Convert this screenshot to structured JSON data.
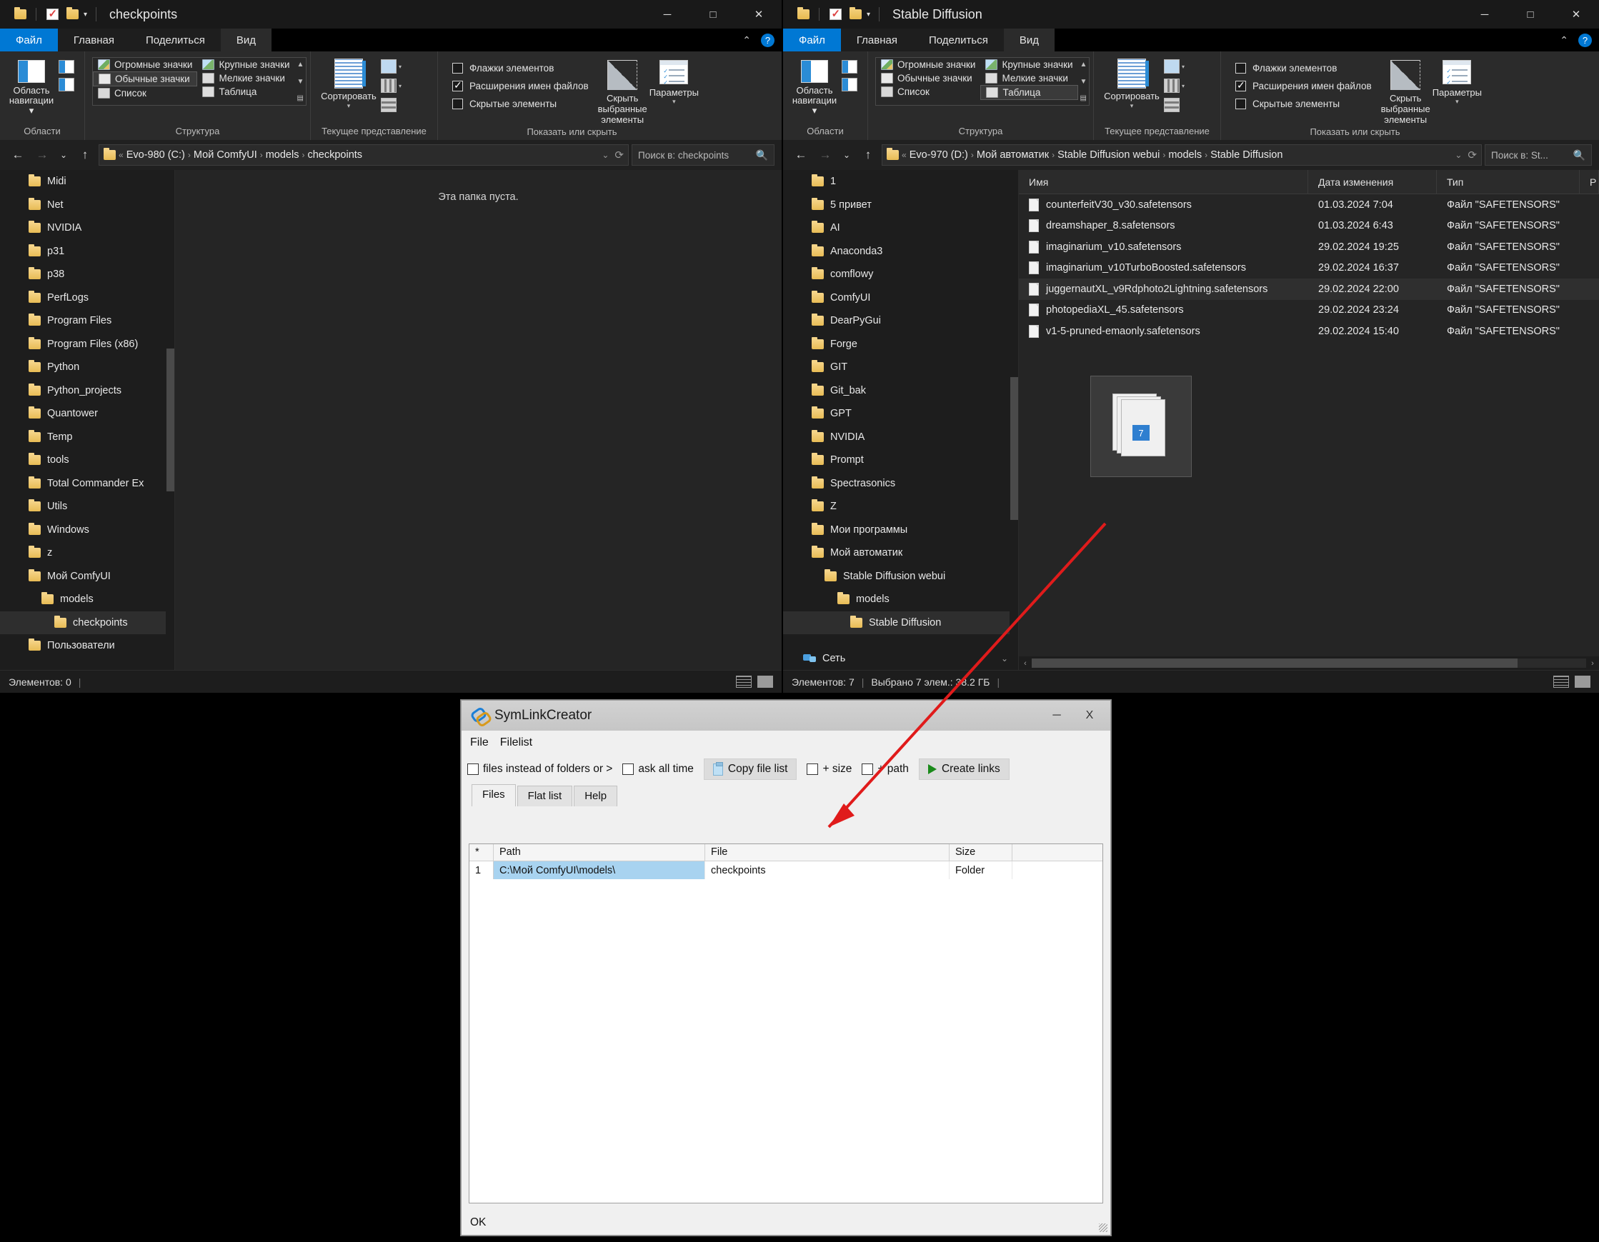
{
  "left_window": {
    "title": "checkpoints",
    "ribbon_tabs": [
      {
        "label": "Файл"
      },
      {
        "label": "Главная"
      },
      {
        "label": "Поделиться"
      },
      {
        "label": "Вид"
      }
    ],
    "groups": {
      "panes": {
        "label": "Области",
        "nav_button": "Область\nнавигации"
      },
      "layout": {
        "label": "Структура",
        "items": [
          "Огромные значки",
          "Крупные значки",
          "Обычные значки",
          "Мелкие значки",
          "Список",
          "Таблица"
        ],
        "selected": "Обычные значки"
      },
      "current_view": {
        "label": "Текущее представление",
        "sort": "Сортировать"
      },
      "show_hide": {
        "label": "Показать или скрыть",
        "checkboxes": [
          {
            "label": "Флажки элементов",
            "checked": false
          },
          {
            "label": "Расширения имен файлов",
            "checked": true
          },
          {
            "label": "Скрытые элементы",
            "checked": false
          }
        ],
        "hide_selected": "Скрыть выбранные\nэлементы",
        "options": "Параметры"
      }
    },
    "address": {
      "crumbs": [
        "Evo-980 (C:)",
        "Мой ComfyUI",
        "models",
        "checkpoints"
      ],
      "prefix": "«"
    },
    "search_placeholder": "Поиск в: checkpoints",
    "tree": [
      {
        "label": "Midi",
        "level": 0
      },
      {
        "label": "Net",
        "level": 0
      },
      {
        "label": "NVIDIA",
        "level": 0
      },
      {
        "label": "p31",
        "level": 0
      },
      {
        "label": "p38",
        "level": 0
      },
      {
        "label": "PerfLogs",
        "level": 0
      },
      {
        "label": "Program Files",
        "level": 0
      },
      {
        "label": "Program Files (x86)",
        "level": 0
      },
      {
        "label": "Python",
        "level": 0
      },
      {
        "label": "Python_projects",
        "level": 0
      },
      {
        "label": "Quantower",
        "level": 0
      },
      {
        "label": "Temp",
        "level": 0
      },
      {
        "label": "tools",
        "level": 0
      },
      {
        "label": "Total Commander Ex",
        "level": 0
      },
      {
        "label": "Utils",
        "level": 0
      },
      {
        "label": "Windows",
        "level": 0
      },
      {
        "label": "z",
        "level": 0
      },
      {
        "label": "Мой ComfyUI",
        "level": 0
      },
      {
        "label": "models",
        "level": 1
      },
      {
        "label": "checkpoints",
        "level": 2,
        "selected": true
      },
      {
        "label": "Пользователи",
        "level": 0
      }
    ],
    "empty_message": "Эта папка пуста.",
    "status": "Элементов: 0"
  },
  "right_window": {
    "title": "Stable Diffusion",
    "ribbon_tabs": [
      {
        "label": "Файл"
      },
      {
        "label": "Главная"
      },
      {
        "label": "Поделиться"
      },
      {
        "label": "Вид"
      }
    ],
    "groups": {
      "panes": {
        "label": "Области",
        "nav_button": "Область\nнавигации"
      },
      "layout": {
        "label": "Структура",
        "items": [
          "Огромные значки",
          "Крупные значки",
          "Обычные значки",
          "Мелкие значки",
          "Список",
          "Таблица"
        ],
        "selected": "Таблица"
      },
      "current_view": {
        "label": "Текущее представление",
        "sort": "Сортировать"
      },
      "show_hide": {
        "label": "Показать или скрыть",
        "checkboxes": [
          {
            "label": "Флажки элементов",
            "checked": false
          },
          {
            "label": "Расширения имен файлов",
            "checked": true
          },
          {
            "label": "Скрытые элементы",
            "checked": false
          }
        ],
        "hide_selected": "Скрыть выбранные\nэлементы",
        "options": "Параметры"
      }
    },
    "address": {
      "crumbs": [
        "Evo-970 (D:)",
        "Мой автоматик",
        "Stable Diffusion webui",
        "models",
        "Stable Diffusion"
      ],
      "prefix": "«"
    },
    "search_placeholder": "Поиск в: St...",
    "tree": [
      {
        "label": "1",
        "level": 0
      },
      {
        "label": "5 привет",
        "level": 0
      },
      {
        "label": "AI",
        "level": 0
      },
      {
        "label": "Anaconda3",
        "level": 0
      },
      {
        "label": "comflowy",
        "level": 0
      },
      {
        "label": "ComfyUI",
        "level": 0
      },
      {
        "label": "DearPyGui",
        "level": 0
      },
      {
        "label": "Forge",
        "level": 0
      },
      {
        "label": "GIT",
        "level": 0
      },
      {
        "label": "Git_bak",
        "level": 0
      },
      {
        "label": "GPT",
        "level": 0
      },
      {
        "label": "NVIDIA",
        "level": 0
      },
      {
        "label": "Prompt",
        "level": 0
      },
      {
        "label": "Spectrasonics",
        "level": 0
      },
      {
        "label": "Z",
        "level": 0
      },
      {
        "label": "Мои программы",
        "level": 0
      },
      {
        "label": "Мой автоматик",
        "level": 0
      },
      {
        "label": "Stable Diffusion webui",
        "level": 1
      },
      {
        "label": "models",
        "level": 2
      },
      {
        "label": "Stable Diffusion",
        "level": 3,
        "selected": true
      }
    ],
    "network_label": "Сеть",
    "columns": [
      "Имя",
      "Дата изменения",
      "Тип",
      "Р"
    ],
    "files": [
      {
        "name": "counterfeitV30_v30.safetensors",
        "date": "01.03.2024 7:04",
        "type": "Файл \"SAFETENSORS\""
      },
      {
        "name": "dreamshaper_8.safetensors",
        "date": "01.03.2024 6:43",
        "type": "Файл \"SAFETENSORS\""
      },
      {
        "name": "imaginarium_v10.safetensors",
        "date": "29.02.2024 19:25",
        "type": "Файл \"SAFETENSORS\""
      },
      {
        "name": "imaginarium_v10TurboBoosted.safetensors",
        "date": "29.02.2024 16:37",
        "type": "Файл \"SAFETENSORS\""
      },
      {
        "name": "juggernautXL_v9Rdphoto2Lightning.safetensors",
        "date": "29.02.2024 22:00",
        "type": "Файл \"SAFETENSORS\"",
        "highlighted": true
      },
      {
        "name": "photopediaXL_45.safetensors",
        "date": "29.02.2024 23:24",
        "type": "Файл \"SAFETENSORS\""
      },
      {
        "name": "v1-5-pruned-emaonly.safetensors",
        "date": "29.02.2024 15:40",
        "type": "Файл \"SAFETENSORS\""
      }
    ],
    "drag_badge": "7",
    "status_items": "Элементов: 7",
    "status_selected": "Выбрано 7 элем.: 38.2 ГБ"
  },
  "symlink_dialog": {
    "title": "SymLinkCreator",
    "menu": [
      "File",
      "Filelist"
    ],
    "toolbar": {
      "files_instead": "files instead of folders or >",
      "ask_all_time": "ask all time",
      "copy_file_list": "Copy file list",
      "plus_size": "+ size",
      "plus_path": "+ path",
      "create_links": "Create links"
    },
    "tabs": [
      {
        "label": "Files",
        "active": true
      },
      {
        "label": "Flat list",
        "active": false
      },
      {
        "label": "Help",
        "active": false
      }
    ],
    "grid_headers": [
      "*",
      "Path",
      "File",
      "Size"
    ],
    "rows": [
      {
        "num": "1",
        "path": "C:\\Мой ComfyUI\\models\\",
        "file": "checkpoints",
        "size": "Folder"
      }
    ],
    "status": "OK"
  },
  "window_controls": {
    "minimize": "─",
    "maximize": "□",
    "close": "✕"
  },
  "colors": {
    "accent": "#0078d4",
    "annotation_red": "#e01b1b",
    "selection_blue": "#a8d3f0"
  }
}
